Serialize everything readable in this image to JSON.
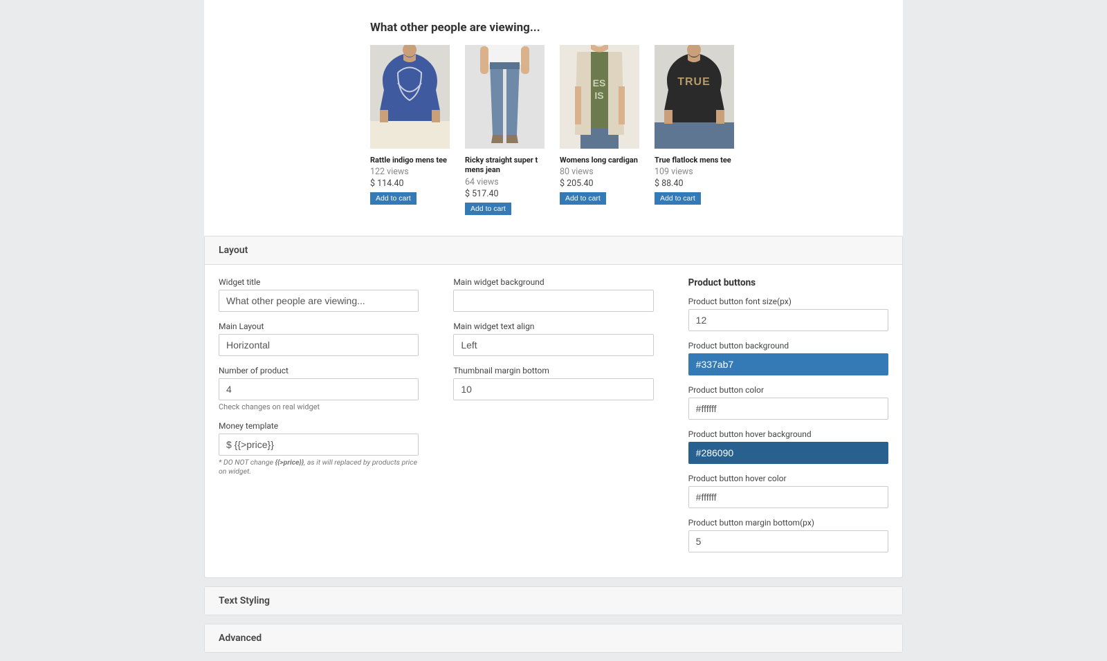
{
  "preview": {
    "heading": "What other people are viewing...",
    "add_to_cart_label": "Add to cart",
    "products": [
      {
        "name": "Rattle indigo mens tee",
        "views": "122 views",
        "price": "$ 114.40"
      },
      {
        "name": "Ricky straight super t mens jean",
        "views": "64 views",
        "price": "$ 517.40"
      },
      {
        "name": "Womens long cardigan",
        "views": "80 views",
        "price": "$ 205.40"
      },
      {
        "name": "True flatlock mens tee",
        "views": "109 views",
        "price": "$ 88.40"
      }
    ]
  },
  "panels": {
    "layout": {
      "title": "Layout"
    },
    "textstyling": {
      "title": "Text Styling"
    },
    "advanced": {
      "title": "Advanced"
    }
  },
  "layout": {
    "col1": {
      "widget_title": {
        "label": "Widget title",
        "value": "What other people are viewing..."
      },
      "main_layout": {
        "label": "Main Layout",
        "value": "Horizontal"
      },
      "num_product": {
        "label": "Number of product",
        "value": "4",
        "help": "Check changes on real widget"
      },
      "money_template": {
        "label": "Money template",
        "value": "$ {{>price}}",
        "help_pre": "* DO NOT change ",
        "help_bold": "{{>price}}",
        "help_post": ", as it will replaced by products price on widget."
      }
    },
    "col2": {
      "main_bg": {
        "label": "Main widget background",
        "value": ""
      },
      "main_align": {
        "label": "Main widget text align",
        "value": "Left"
      },
      "thumb_margin": {
        "label": "Thumbnail margin bottom",
        "value": "10"
      }
    },
    "col3": {
      "section": "Product buttons",
      "btn_font": {
        "label": "Product button font size(px)",
        "value": "12"
      },
      "btn_bg": {
        "label": "Product button background",
        "value": "#337ab7"
      },
      "btn_color": {
        "label": "Product button color",
        "value": "#ffffff"
      },
      "btn_hover_bg": {
        "label": "Product button hover background",
        "value": "#286090"
      },
      "btn_hover_c": {
        "label": "Product button hover color",
        "value": "#ffffff"
      },
      "btn_margin": {
        "label": "Product button margin bottom(px)",
        "value": "5"
      }
    }
  }
}
